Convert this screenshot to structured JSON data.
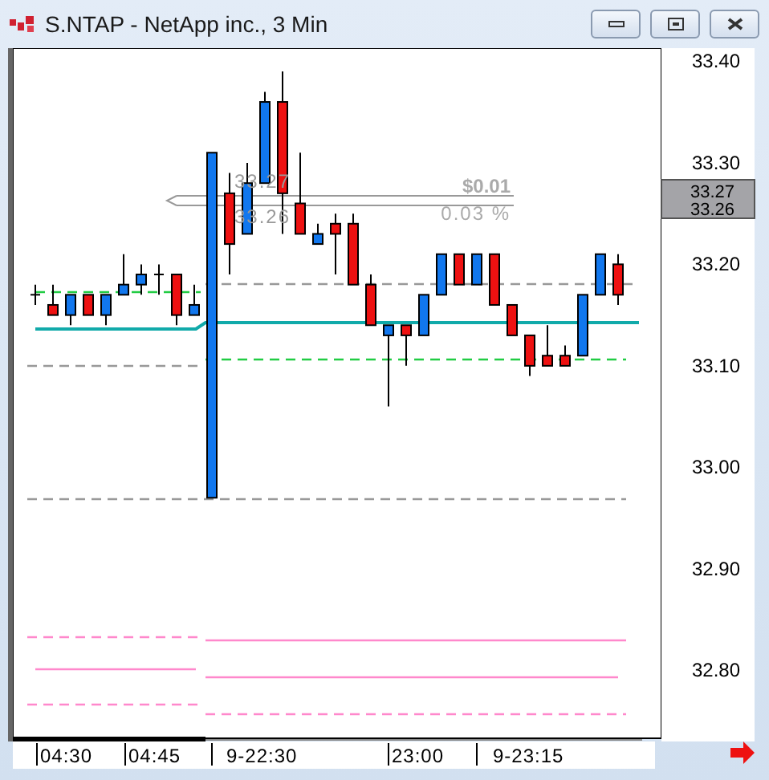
{
  "window": {
    "title": "S.NTAP - NetApp inc., 3 Min"
  },
  "price_axis": {
    "current_prices": [
      "33.27",
      "33.26"
    ]
  },
  "crosshair": {
    "prices": [
      "33.27",
      "33.26"
    ],
    "change_amount": "$0.01",
    "change_percent": "0.03 %"
  },
  "time_axis": {
    "labels": [
      "04:30",
      "04:45",
      "9-22:30",
      "23:00",
      "9-23:15"
    ]
  },
  "chart_data": {
    "type": "candlestick",
    "ylim": [
      32.733,
      33.413
    ],
    "categories": [
      null,
      null,
      null,
      null,
      null,
      null,
      null,
      null,
      null,
      null,
      null,
      null,
      null,
      null,
      null,
      null,
      null,
      null,
      null,
      null,
      null,
      null,
      null,
      null,
      null,
      null,
      null,
      null,
      null,
      null,
      null,
      null,
      null,
      null
    ],
    "yticks": [
      {
        "value": 33.4,
        "label": "33.40"
      },
      {
        "value": 33.3,
        "label": "33.30"
      },
      {
        "value": 33.2,
        "label": "33.20"
      },
      {
        "value": 33.1,
        "label": "33.10"
      },
      {
        "value": 33.0,
        "label": "33.00"
      },
      {
        "value": 32.9,
        "label": "32.90"
      },
      {
        "value": 32.8,
        "label": "32.80"
      }
    ],
    "ohlc": [
      [
        33.17,
        33.18,
        33.16,
        33.17
      ],
      [
        33.16,
        33.18,
        33.15,
        33.15
      ],
      [
        33.15,
        33.17,
        33.14,
        33.17
      ],
      [
        33.17,
        33.17,
        33.15,
        33.15
      ],
      [
        33.15,
        33.17,
        33.14,
        33.17
      ],
      [
        33.17,
        33.21,
        33.17,
        33.18
      ],
      [
        33.18,
        33.2,
        33.17,
        33.19
      ],
      [
        33.19,
        33.2,
        33.17,
        33.19
      ],
      [
        33.19,
        33.19,
        33.14,
        33.15
      ],
      [
        33.15,
        33.18,
        33.15,
        33.16
      ],
      [
        32.97,
        33.31,
        32.97,
        33.31
      ],
      [
        33.27,
        33.29,
        33.19,
        33.22
      ],
      [
        33.23,
        33.3,
        33.23,
        33.28
      ],
      [
        33.28,
        33.37,
        33.28,
        33.36
      ],
      [
        33.36,
        33.39,
        33.23,
        33.27
      ],
      [
        33.26,
        33.31,
        33.23,
        33.23
      ],
      [
        33.22,
        33.24,
        33.22,
        33.23
      ],
      [
        33.24,
        33.25,
        33.19,
        33.23
      ],
      [
        33.24,
        33.25,
        33.18,
        33.18
      ],
      [
        33.18,
        33.19,
        33.14,
        33.14
      ],
      [
        33.13,
        33.14,
        33.06,
        33.14
      ],
      [
        33.14,
        33.14,
        33.1,
        33.13
      ],
      [
        33.13,
        33.17,
        33.13,
        33.17
      ],
      [
        33.17,
        33.21,
        33.17,
        33.21
      ],
      [
        33.21,
        33.21,
        33.18,
        33.18
      ],
      [
        33.18,
        33.21,
        33.18,
        33.21
      ],
      [
        33.21,
        33.21,
        33.16,
        33.16
      ],
      [
        33.16,
        33.16,
        33.13,
        33.13
      ],
      [
        33.13,
        33.13,
        33.09,
        33.1
      ],
      [
        33.11,
        33.14,
        33.1,
        33.1
      ],
      [
        33.11,
        33.12,
        33.1,
        33.1
      ],
      [
        33.11,
        33.17,
        33.11,
        33.17
      ],
      [
        33.17,
        33.21,
        33.17,
        33.21
      ],
      [
        33.2,
        33.21,
        33.16,
        33.17
      ]
    ]
  }
}
